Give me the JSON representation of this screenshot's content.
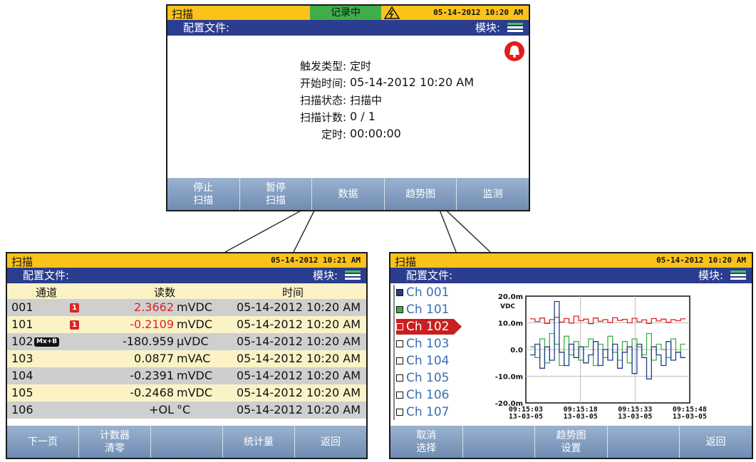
{
  "top": {
    "status_title": "扫描",
    "recording": "记录中",
    "clock": "05-14-2012 10:20 AM",
    "profile_label": "配置文件:",
    "module_label": "模块:",
    "info": [
      {
        "key": "触发类型:",
        "value": "定时"
      },
      {
        "key": "开始时间:",
        "value": "05-14-2012 10:20 AM"
      },
      {
        "key": "扫描状态:",
        "value": "扫描中"
      },
      {
        "key": "扫描计数:",
        "value": "0 / 1"
      },
      {
        "key": "定时:",
        "value": "00:00:00"
      }
    ],
    "fkeys": [
      {
        "l1": "停止",
        "l2": "扫描"
      },
      {
        "l1": "暂停",
        "l2": "扫描"
      },
      {
        "l1": "数据",
        "l2": ""
      },
      {
        "l1": "趋势图",
        "l2": ""
      },
      {
        "l1": "监测",
        "l2": ""
      }
    ]
  },
  "data_screen": {
    "status_title": "扫描",
    "clock": "05-14-2012 10:21 AM",
    "profile_label": "配置文件:",
    "module_label": "模块:",
    "headers": {
      "channel": "通道",
      "reading": "读数",
      "time": "时间"
    },
    "rows": [
      {
        "ch": "001",
        "badge": "1",
        "reading": "2.3662",
        "unit": "mVDC",
        "time": "05-14-2012 10:20 AM"
      },
      {
        "ch": "101",
        "badge": "1",
        "reading": "-0.2109",
        "unit": "mVDC",
        "time": "05-14-2012 10:20 AM"
      },
      {
        "ch": "102",
        "badge": "Mx+B",
        "reading": "-180.959",
        "unit": "µVDC",
        "time": "05-14-2012 10:20 AM"
      },
      {
        "ch": "103",
        "badge": "",
        "reading": "0.0877",
        "unit": "mVAC",
        "time": "05-14-2012 10:20 AM"
      },
      {
        "ch": "104",
        "badge": "",
        "reading": "-0.2391",
        "unit": "mVDC",
        "time": "05-14-2012 10:20 AM"
      },
      {
        "ch": "105",
        "badge": "",
        "reading": "-0.2468",
        "unit": "mVDC",
        "time": "05-14-2012 10:20 AM"
      },
      {
        "ch": "106",
        "badge": "",
        "reading": "+OL",
        "unit": "°C",
        "time": "05-14-2012 10:20 AM"
      }
    ],
    "fkeys": [
      {
        "l1": "下一页",
        "l2": ""
      },
      {
        "l1": "计数器",
        "l2": "清零"
      },
      {
        "l1": "",
        "l2": ""
      },
      {
        "l1": "统计量",
        "l2": ""
      },
      {
        "l1": "返回",
        "l2": ""
      }
    ]
  },
  "trend_screen": {
    "status_title": "扫描",
    "clock": "05-14-2012 10:20 AM",
    "profile_label": "配置文件:",
    "module_label": "模块:",
    "channels": [
      {
        "label": "Ch 001",
        "fill": "#1f3f8a",
        "selected": false
      },
      {
        "label": "Ch 101",
        "fill": "#3fae49",
        "selected": false
      },
      {
        "label": "Ch 102",
        "fill": "#e02020",
        "selected": true
      },
      {
        "label": "Ch 103",
        "fill": "#ffffff",
        "selected": false
      },
      {
        "label": "Ch 104",
        "fill": "#ffffff",
        "selected": false
      },
      {
        "label": "Ch 105",
        "fill": "#ffffff",
        "selected": false
      },
      {
        "label": "Ch 106",
        "fill": "#ffffff",
        "selected": false
      },
      {
        "label": "Ch 107",
        "fill": "#ffffff",
        "selected": false
      }
    ],
    "fkeys": [
      {
        "l1": "取消",
        "l2": "选择"
      },
      {
        "l1": "",
        "l2": ""
      },
      {
        "l1": "趋势图",
        "l2": "设置"
      },
      {
        "l1": "",
        "l2": ""
      },
      {
        "l1": "返回",
        "l2": ""
      }
    ]
  },
  "chart_data": {
    "type": "line",
    "ylabel": "VDC",
    "yticks": [
      "20.0m",
      "10.0m",
      "0.0",
      "-10.0m",
      "-20.0m"
    ],
    "ylim": [
      -0.02,
      0.02
    ],
    "xticks": [
      {
        "time": "09:15:03",
        "date": "13-03-05"
      },
      {
        "time": "09:15:18",
        "date": "13-03-05"
      },
      {
        "time": "09:15:33",
        "date": "13-03-05"
      },
      {
        "time": "09:15:48",
        "date": "13-03-05"
      }
    ],
    "grid": true,
    "series": [
      {
        "color": "#e02020",
        "values": [
          0.0115,
          0.0105,
          0.0118,
          0.0098,
          0.0112,
          0.0121,
          0.0103,
          0.0116,
          0.0099,
          0.0125,
          0.0108,
          0.0114,
          0.0097,
          0.0118,
          0.0106,
          0.0112,
          0.0101,
          0.0119,
          0.0109,
          0.0113,
          0.01,
          0.0117,
          0.0104,
          0.0111,
          0.0098,
          0.0116,
          0.0107,
          0.0114,
          0.0102,
          0.0112,
          0.0108,
          0.0115
        ]
      },
      {
        "color": "#3fae49",
        "values": [
          0.001,
          -0.003,
          0.004,
          -0.005,
          0.006,
          0.002,
          -0.006,
          0.005,
          -0.002,
          0.003,
          -0.004,
          0.001,
          0.004,
          -0.006,
          0.002,
          -0.003,
          0.005,
          -0.001,
          -0.004,
          0.003,
          -0.005,
          0.004,
          0.001,
          -0.002,
          0.006,
          -0.004,
          0.002,
          0.0,
          -0.003,
          0.004,
          -0.001,
          0.002
        ]
      },
      {
        "color": "#1f3f8a",
        "values": [
          -0.002,
          0.002,
          -0.007,
          0.001,
          -0.004,
          0.018,
          -0.001,
          -0.006,
          0.002,
          -0.003,
          0.001,
          -0.005,
          -0.002,
          0.003,
          -0.006,
          0.0,
          -0.004,
          0.002,
          -0.007,
          -0.001,
          0.001,
          -0.009,
          0.002,
          -0.003,
          -0.011,
          0.001,
          -0.002,
          -0.006,
          0.003,
          -0.004,
          -0.001,
          -0.003
        ]
      }
    ]
  }
}
